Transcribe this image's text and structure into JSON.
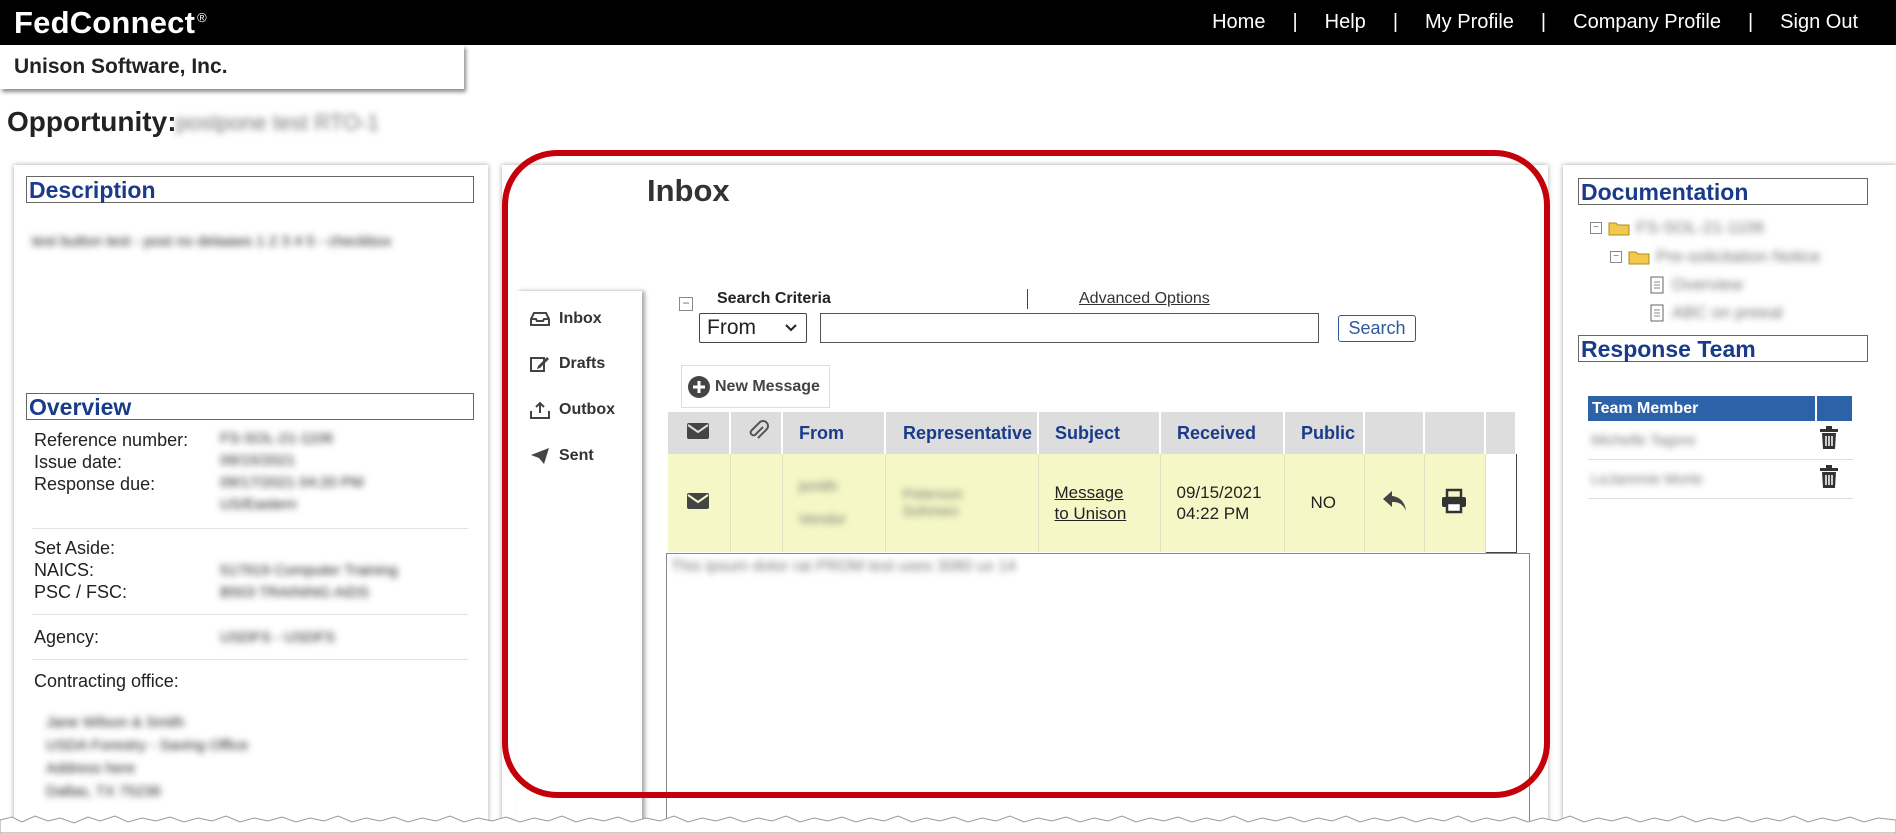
{
  "app": {
    "logo": "FedConnect",
    "logo_mark": "®",
    "nav": [
      "Home",
      "Help",
      "My Profile",
      "Company Profile",
      "Sign Out"
    ],
    "nav_sep": "|"
  },
  "company": "Unison Software, Inc.",
  "opportunity": {
    "label": "Opportunity:",
    "value": "postpone test RTO-1"
  },
  "left_panel": {
    "description_title": "Description",
    "description_text": "test button test - post no delaaws 1 2 3 4 5 - checkbox",
    "overview_title": "Overview",
    "fields": {
      "reference_label": "Reference number:",
      "reference_value": "FS-SOL-21-1106",
      "issue_label": "Issue date:",
      "issue_value": "09/15/2021",
      "due_label": "Response due:",
      "due_value": "09/17/2021 04:20 PM",
      "due_value_2": "US/Eastern",
      "setaside_label": "Set Aside:",
      "naics_label": "NAICS:",
      "naics_value": "517919 Computer Training",
      "psc_label": "PSC / FSC:",
      "psc_value": "B503 TRAINING AIDS",
      "agency_label": "Agency:",
      "agency_value": "USDFS - USDFS",
      "office_label": "Contracting office:",
      "office_lines": [
        "Jane Wilson & Smith",
        "USDA Forestry - Saving Office",
        "Address here",
        "Dallas, TX 75236"
      ]
    }
  },
  "inbox": {
    "title": "Inbox",
    "nav": [
      "Inbox",
      "Drafts",
      "Outbox",
      "Sent"
    ],
    "search_criteria_label": "Search Criteria",
    "collapse_symbol": "−",
    "advanced_options": "Advanced Options",
    "from_selected": "From",
    "search_button": "Search",
    "new_message": "New Message",
    "columns": [
      "From",
      "Representative",
      "Subject",
      "Received",
      "Public"
    ],
    "rows": [
      {
        "from_line1": "jsmith",
        "from_line2": "Vendor",
        "representative": "Peterson Sohmen",
        "subject": "Message to Unison",
        "received_date": "09/15/2021",
        "received_time": "04:22 PM",
        "public": "NO"
      }
    ],
    "preview_text": "This ipsum dolor rat PROM test uses 3080 ux 14"
  },
  "right_panel": {
    "documentation_title": "Documentation",
    "tree": {
      "root": "FS-SOL-21-1106",
      "folder": "Pre-solicitation Notice",
      "docs": [
        "Overview",
        "ABC on preeal"
      ]
    },
    "team_title": "Response Team",
    "team_header": "Team Member",
    "team_members": [
      "Michelle Tagore",
      "LeJammie Morte"
    ]
  },
  "colors": {
    "accent_red": "#c4000b",
    "heading_blue": "#1a3b8a",
    "row_highlight": "#f5f8c6",
    "team_header_bg": "#2b62a8"
  }
}
